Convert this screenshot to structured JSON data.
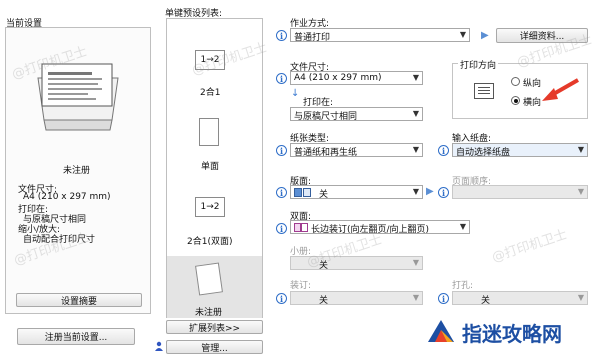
{
  "left": {
    "title": "当前设置",
    "status": "未注册",
    "paper_size_label": "文件尺寸:",
    "paper_size_value": "A4 (210 x 297 mm)",
    "print_on_label": "打印在:",
    "print_on_value": "与原稿尺寸相同",
    "scale_label": "缩小/放大:",
    "scale_value": "自动配合打印尺寸",
    "summary_button": "设置摘要",
    "register_button": "注册当前设置..."
  },
  "presets": {
    "title": "单键预设列表:",
    "items": [
      {
        "icon": "1→2",
        "label": "2合1"
      },
      {
        "icon": "",
        "label": "单面"
      },
      {
        "icon": "1→2",
        "label": "2合1(双面)"
      },
      {
        "icon": "",
        "label": "未注册"
      }
    ],
    "expand_button": "扩展列表>>",
    "manage_button": "管理..."
  },
  "right": {
    "job_type_label": "作业方式:",
    "job_type_value": "普通打印",
    "details_button": "详细资料...",
    "doc_size_label": "文件尺寸:",
    "doc_size_value": "A4 (210 x 297 mm)",
    "print_on_label": "打印在:",
    "print_on_value": "与原稿尺寸相同",
    "orientation_title": "打印方向",
    "portrait_label": "纵向",
    "landscape_label": "横向",
    "paper_type_label": "纸张类型:",
    "paper_type_value": "普通纸和再生纸",
    "input_tray_label": "输入纸盘:",
    "input_tray_value": "自动选择纸盘",
    "layout_label": "版面:",
    "layout_value": "关",
    "page_order_label": "页面顺序:",
    "duplex_label": "双面:",
    "duplex_value": "长边装订(向左翻页/向上翻页)",
    "booklet_label": "小册:",
    "booklet_value": "关",
    "staple_label": "装订:",
    "staple_value": "关",
    "punch_label": "打孔:",
    "punch_value": "关"
  },
  "watermarks": [
    "@打印机卫士",
    "@打印机卫士",
    "@打印机卫士",
    "@打印机卫士",
    "@打印机卫士",
    "@打印机卫士"
  ],
  "brand": {
    "text": "指迷攻略网",
    "color": "#1d4fa3",
    "accent": "#e8402a"
  }
}
